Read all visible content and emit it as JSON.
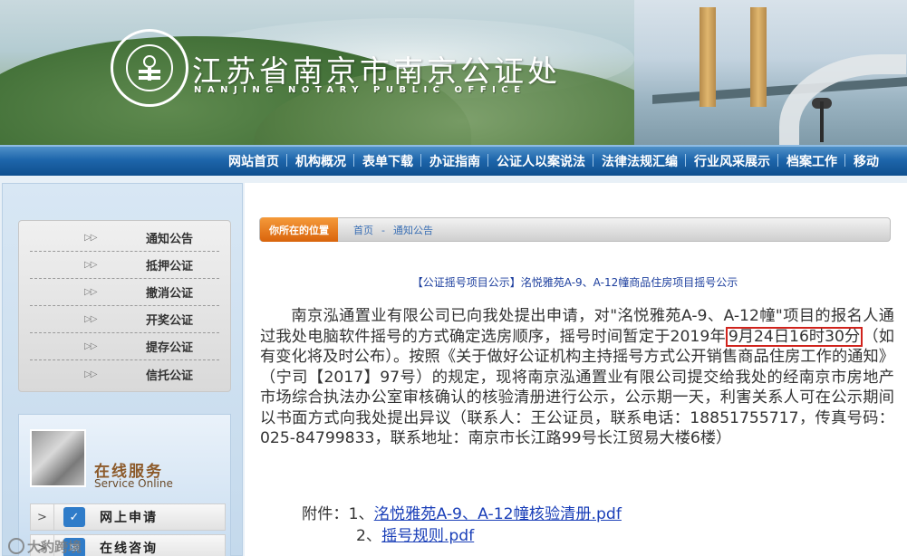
{
  "header": {
    "title": "江苏省南京市南京公证处",
    "subtitle": "NANJING NOTARY PUBLIC OFFICE",
    "seal_text": "南京公证处 · NANJING NOTARY PUBLIC OFFICE"
  },
  "nav": {
    "items": [
      {
        "label": "网站首页"
      },
      {
        "label": "机构概况"
      },
      {
        "label": "表单下载"
      },
      {
        "label": "办证指南"
      },
      {
        "label": "公证人以案说法"
      },
      {
        "label": "法律法规汇编"
      },
      {
        "label": "行业风采展示"
      },
      {
        "label": "档案工作"
      },
      {
        "label": "移动"
      }
    ]
  },
  "sidebar": {
    "menu": [
      {
        "label": "通知公告",
        "marker": "▷▷"
      },
      {
        "label": "抵押公证",
        "marker": "▷▷"
      },
      {
        "label": "撤消公证",
        "marker": "▷▷"
      },
      {
        "label": "开奖公证",
        "marker": "▷▷"
      },
      {
        "label": "提存公证",
        "marker": "▷▷"
      },
      {
        "label": "信托公证",
        "marker": "▷▷"
      }
    ],
    "service": {
      "title": "在线服务",
      "subtitle": "Service Online",
      "buttons": [
        {
          "label": "网上申请",
          "arrow": ">",
          "icon": "checkmark-icon"
        },
        {
          "label": "在线咨询",
          "arrow": ">",
          "icon": "chat-icon"
        }
      ]
    }
  },
  "breadcrumb": {
    "tag": "你所在的位置",
    "home": "首页",
    "separator": "-",
    "current": "通知公告"
  },
  "article": {
    "title": "【公证摇号项目公示】洺悦雅苑A-9、A-12幢商品住房项目摇号公示",
    "p1_before": "南京泓通置业有限公司已向我处提出申请，对\"洺悦雅苑A-9、A-12幢\"项目的报名人通过我处电脑软件摇号的方式确定选房顺序，摇号时间暂定于2019年",
    "p1_highlight": "9月24日16时30分",
    "p1_after": "（如有变化将及时公布）。按照《关于做好公证机构主持摇号方式公开销售商品住房工作的通知》（宁司【2017】97号）的规定，现将南京泓通置业有限公司提交给我处的经南京市房地产市场综合执法办公室审核确认的核验清册进行公示，公示期一天，利害关系人可在公示期间以书面方式向我处提出异议（联系人：王公证员，联系电话：18851755717，传真号码：025-84799833，联系地址：南京市长江路99号长江贸易大楼6楼）",
    "attachments_label": "附件：",
    "attachments": [
      {
        "index": "1、",
        "name": "洺悦雅苑A-9、A-12幢核验清册.pdf"
      },
      {
        "index": "2、",
        "name": "摇号规则.pdf"
      }
    ]
  },
  "watermark": "大豹跨境",
  "colors": {
    "nav_bg": "#1e66ab",
    "crumb_tag": "#e8781f",
    "title_blue": "#1d3f9e",
    "link_blue": "#1a3fb8",
    "highlight_red": "#d0231c"
  }
}
